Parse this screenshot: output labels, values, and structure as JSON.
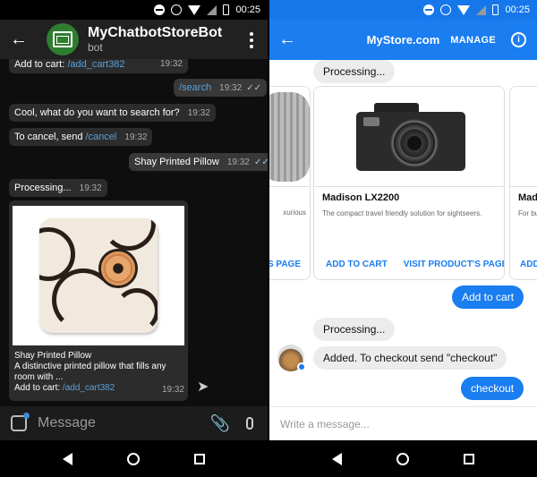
{
  "status": {
    "time": "00:25"
  },
  "telegram": {
    "header": {
      "name": "MyChatbotStoreBot",
      "subtitle": "bot"
    },
    "messages": {
      "m1_text": "Add to cart:",
      "m1_link": "/add_cart382",
      "m1_time": "19:32",
      "m2_link": "/search",
      "m2_time": "19:32",
      "m3_text": "Cool, what do you want to search for?",
      "m3_time": "19:32",
      "m4_text": "To cancel, send",
      "m4_link": "/cancel",
      "m4_time": "19:32",
      "m5_text": "Shay Printed Pillow",
      "m5_time": "19:32",
      "m6_text": "Processing...",
      "m6_time": "19:32"
    },
    "product_card": {
      "title": "Shay Printed Pillow",
      "desc1": "A distinctive printed pillow that fills any",
      "desc2": "room with ...",
      "add_text": "Add to cart:",
      "add_link": "/add_cart382",
      "time": "19:32"
    },
    "input": {
      "placeholder": "Message"
    }
  },
  "messenger": {
    "header": {
      "title": "MyStore.com",
      "manage": "MANAGE"
    },
    "messages": {
      "processing1": "Processing...",
      "add_to_cart": "Add to cart",
      "processing2": "Processing...",
      "added": "Added. To checkout send \"checkout\"",
      "checkout": "checkout"
    },
    "cards": [
      {
        "title": "",
        "subtitle": "xurious",
        "btn1": "'S PAGE",
        "btn2": ""
      },
      {
        "title": "Madison LX2200",
        "subtitle": "The compact travel friendly solution for sightseers.",
        "btn1": "ADD TO CART",
        "btn2": "VISIT PRODUCT'S PAGE"
      },
      {
        "title": "Madi",
        "subtitle": "For bu",
        "btn1": "ADD",
        "btn2": ""
      }
    ],
    "input": {
      "placeholder": "Write a message..."
    }
  }
}
